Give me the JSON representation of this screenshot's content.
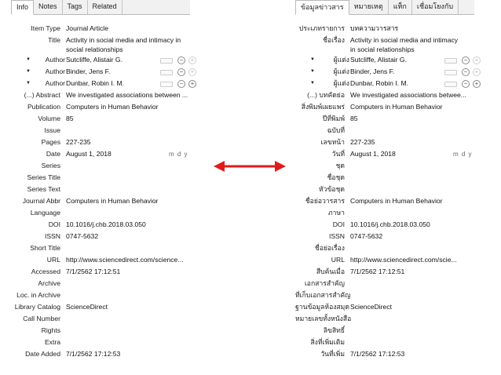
{
  "left": {
    "tabs": [
      "Info",
      "Notes",
      "Tags",
      "Related"
    ],
    "title_line1": "Activity in social media and intimacy in",
    "title_line2": "social relationships",
    "authors": [
      {
        "label": "Author",
        "value": "Sutcliffe, Alistair G."
      },
      {
        "label": "Author",
        "value": "Binder, Jens F."
      },
      {
        "label": "Author",
        "value": "Dunbar, Robin I. M."
      }
    ],
    "fields": {
      "item_type": {
        "label": "Item Type",
        "value": "Journal Article"
      },
      "title": {
        "label": "Title"
      },
      "abstract": {
        "label": "(...) Abstract",
        "value": "We investigated associations between ..."
      },
      "publication": {
        "label": "Publication",
        "value": "Computers in Human Behavior"
      },
      "volume": {
        "label": "Volume",
        "value": "85"
      },
      "issue": {
        "label": "Issue",
        "value": ""
      },
      "pages": {
        "label": "Pages",
        "value": "227-235"
      },
      "date": {
        "label": "Date",
        "value": "August 1, 2018",
        "format": "m d y"
      },
      "series": {
        "label": "Series",
        "value": ""
      },
      "series_title": {
        "label": "Series Title",
        "value": ""
      },
      "series_text": {
        "label": "Series Text",
        "value": ""
      },
      "journal_abbr": {
        "label": "Journal Abbr",
        "value": "Computers in Human Behavior"
      },
      "language": {
        "label": "Language",
        "value": ""
      },
      "doi": {
        "label": "DOI",
        "value": "10.1016/j.chb.2018.03.050"
      },
      "issn": {
        "label": "ISSN",
        "value": "0747-5632"
      },
      "short_title": {
        "label": "Short Title",
        "value": ""
      },
      "url": {
        "label": "URL",
        "value": "http://www.sciencedirect.com/science..."
      },
      "accessed": {
        "label": "Accessed",
        "value": "7/1/2562 17:12:51"
      },
      "archive": {
        "label": "Archive",
        "value": ""
      },
      "loc_archive": {
        "label": "Loc. in Archive",
        "value": ""
      },
      "library_catalog": {
        "label": "Library Catalog",
        "value": "ScienceDirect"
      },
      "call_number": {
        "label": "Call Number",
        "value": ""
      },
      "rights": {
        "label": "Rights",
        "value": ""
      },
      "extra": {
        "label": "Extra",
        "value": ""
      },
      "date_added": {
        "label": "Date Added",
        "value": "7/1/2562 17:12:53"
      }
    }
  },
  "right": {
    "tabs": [
      "ข้อมูลข่าวสาร",
      "หมายเหตุ",
      "แท็ก",
      "เชื่อมโยงกับ"
    ],
    "title_line1": "Activity in social media and intimacy",
    "title_line2": "in social relationships",
    "authors": [
      {
        "label": "ผู้แต่ง",
        "value": "Sutcliffe, Alistair G."
      },
      {
        "label": "ผู้แต่ง",
        "value": "Binder, Jens F."
      },
      {
        "label": "ผู้แต่ง",
        "value": "Dunbar, Robin I. M."
      }
    ],
    "fields": {
      "item_type": {
        "label": "ประเภทรายการ",
        "value": "บทความวารสาร"
      },
      "title": {
        "label": "ชื่อเรื่อง"
      },
      "abstract": {
        "label": "(...) บทคัดย่อ",
        "value": "We investigated associations betwee..."
      },
      "publication": {
        "label": "สิ่งพิมพ์เผยแพร่",
        "value": "Computers in Human Behavior"
      },
      "volume": {
        "label": "ปีที่พิมพ์",
        "value": "85"
      },
      "issue": {
        "label": "ฉบับที่",
        "value": ""
      },
      "pages": {
        "label": "เลขหน้า",
        "value": "227-235"
      },
      "date": {
        "label": "วันที่",
        "value": "August 1, 2018",
        "format": "m d y"
      },
      "series": {
        "label": "ชุด",
        "value": ""
      },
      "series_title": {
        "label": "ชื่อชุด",
        "value": ""
      },
      "series_text": {
        "label": "หัวข้อชุด",
        "value": ""
      },
      "journal_abbr": {
        "label": "ชื่อย่อวารสาร",
        "value": "Computers in Human Behavior"
      },
      "language": {
        "label": "ภาษา",
        "value": ""
      },
      "doi": {
        "label": "DOI",
        "value": "10.1016/j.chb.2018.03.050"
      },
      "issn": {
        "label": "ISSN",
        "value": "0747-5632"
      },
      "short_title": {
        "label": "ชื่อย่อเรื่อง",
        "value": ""
      },
      "url": {
        "label": "URL",
        "value": "http://www.sciencedirect.com/scie..."
      },
      "accessed": {
        "label": "สืบค้นเมื่อ",
        "value": "7/1/2562 17:12:51"
      },
      "archive": {
        "label": "เอกสารสำคัญ",
        "value": ""
      },
      "loc_archive": {
        "label": "ที่เก็บเอกสารสำคัญ",
        "value": ""
      },
      "library_catalog": {
        "label": "ฐานข้อมูลห้องสมุด",
        "value": "ScienceDirect"
      },
      "call_number": {
        "label": "หมายเลขทั้งหนังสือ",
        "value": ""
      },
      "rights": {
        "label": "ลิขสิทธิ์",
        "value": ""
      },
      "extra": {
        "label": "สิ่งที่เพิ่มเติม",
        "value": ""
      },
      "date_added": {
        "label": "วันที่เพิ่ม",
        "value": "7/1/2562 17:12:53"
      }
    }
  },
  "colors": {
    "arrow": "#e01b1b",
    "tab_border": "#b9b9b9"
  },
  "icons": {
    "expand": "triangle-down-icon",
    "remove": "minus-circle-icon",
    "add": "plus-circle-icon",
    "arrow": "double-arrow-icon"
  }
}
